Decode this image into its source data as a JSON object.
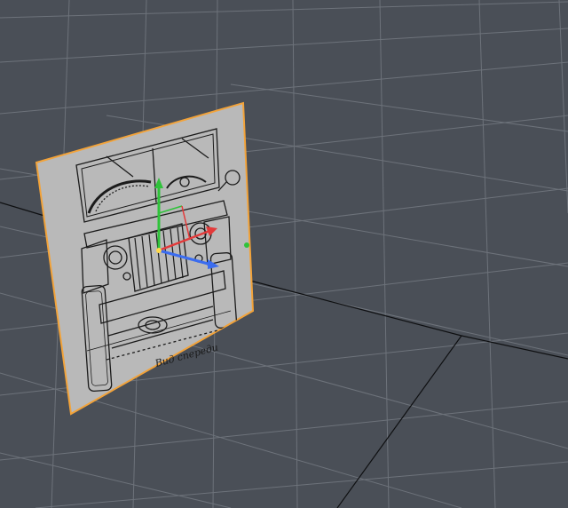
{
  "viewport": {
    "background_color": "#4a4f57",
    "grid_color": "#8a9098",
    "axis_line_color": "#0e0f11",
    "selection_outline_color": "#f2a33a"
  },
  "reference_plane": {
    "caption": "Вид спереди",
    "selected": true
  },
  "gizmo": {
    "x_axis_color": "#3a6cf0",
    "y_axis_color": "#2fc23a",
    "z_axis_color": "#e33a3a"
  }
}
